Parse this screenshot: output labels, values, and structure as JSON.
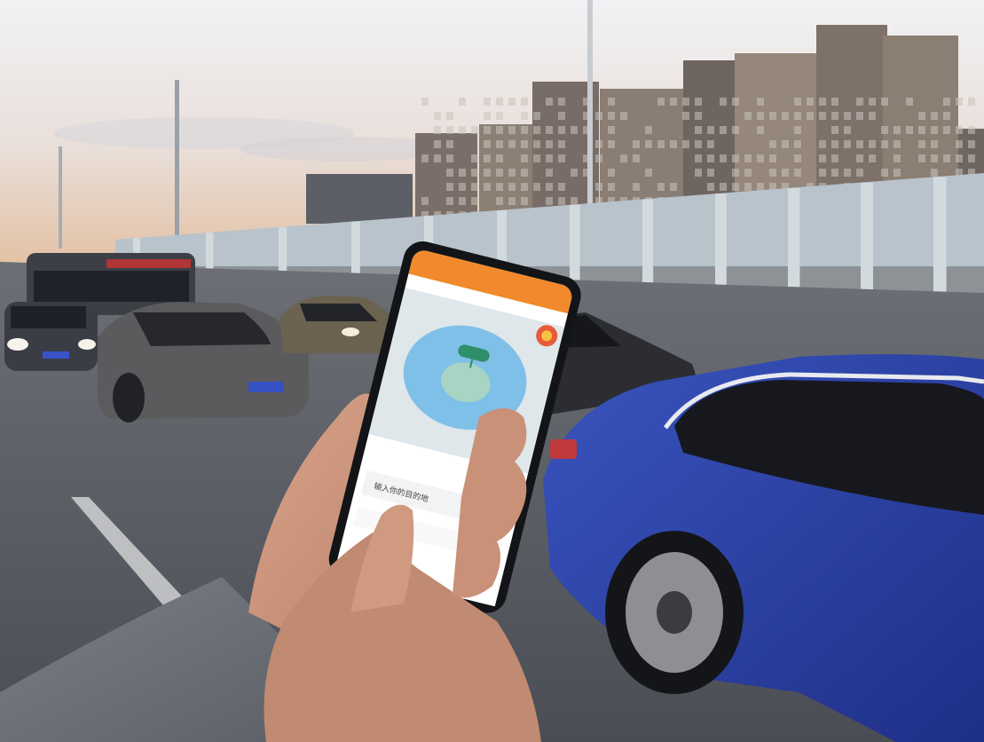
{
  "phone_screen": {
    "app_header_text": "",
    "map_pin_label": "",
    "destination_placeholder": "输入你的目的地"
  },
  "colors": {
    "app_orange": "#f08a2c",
    "map_blue": "#7fc0e8",
    "map_green": "#2f8f6a",
    "car_blue": "#2a3f9e",
    "sky_top": "#eaeef2",
    "sky_bottom": "#e6c2a2",
    "road": "#55585f"
  },
  "icons": [
    "map-pin-icon",
    "mascot-icon"
  ]
}
